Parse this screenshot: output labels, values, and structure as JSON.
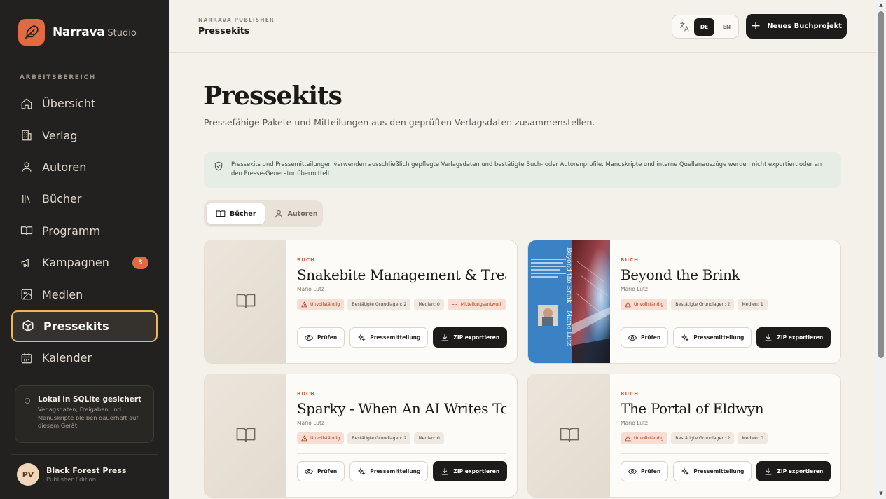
{
  "brand": {
    "name": "Narrava",
    "suffix": "Studio"
  },
  "sidebar": {
    "section_label": "ARBEITSBEREICH",
    "items": [
      {
        "label": "Übersicht",
        "icon": "home-icon"
      },
      {
        "label": "Verlag",
        "icon": "building-icon"
      },
      {
        "label": "Autoren",
        "icon": "user-icon"
      },
      {
        "label": "Bücher",
        "icon": "library-icon"
      },
      {
        "label": "Programm",
        "icon": "open-book-icon"
      },
      {
        "label": "Kampagnen",
        "icon": "megaphone-icon",
        "badge": "3"
      },
      {
        "label": "Medien",
        "icon": "image-icon"
      },
      {
        "label": "Pressekits",
        "icon": "package-icon",
        "active": true
      },
      {
        "label": "Kalender",
        "icon": "calendar-icon"
      }
    ],
    "storage": {
      "title": "Lokal in SQLite gesichert",
      "text": "Verlagsdaten, Freigaben und Manuskripte bleiben dauerhaft auf diesem Gerät."
    },
    "user": {
      "initials": "PV",
      "name": "Black Forest Press",
      "edition": "Publisher Edition"
    }
  },
  "header": {
    "kicker": "NARRAVA PUBLISHER",
    "title": "Pressekits",
    "lang": {
      "de": "DE",
      "en": "EN",
      "selected": "DE"
    },
    "new_button": "Neues Buchprojekt"
  },
  "main": {
    "title": "Pressekits",
    "subtitle": "Pressefähige Pakete und Mitteilungen aus den geprüften Verlagsdaten zusammenstellen.",
    "notice": "Pressekits und Pressemitteilungen verwenden ausschließlich gepflegte Verlagsdaten und bestätigte Buch- oder Autorenprofile. Manuskripte und interne Quellenauszüge werden nicht exportiert oder an den Presse-Generator übermittelt.",
    "tabs": {
      "books": "Bücher",
      "authors": "Autoren"
    }
  },
  "cards": [
    {
      "kicker": "BUCH",
      "title": "Snakebite Management & Treat...",
      "author": "Mario Lutz",
      "chips": [
        "Unvollständig",
        "Bestätigte Grundlagen: 2",
        "Medien: 0",
        "Mitteilungsentwurf"
      ],
      "has_cover": false
    },
    {
      "kicker": "BUCH",
      "title": "Beyond the Brink",
      "author": "Mario Lutz",
      "chips": [
        "Unvollständig",
        "Bestätigte Grundlagen: 2",
        "Medien: 1"
      ],
      "has_cover": true,
      "cover_text": {
        "spine_title": "Beyond the Brink",
        "spine_author": "Mario Lutz"
      }
    },
    {
      "kicker": "BUCH",
      "title": "Sparky - When An AI Writes To ...",
      "author": "Mario Lutz",
      "chips": [
        "Unvollständig",
        "Bestätigte Grundlagen: 2",
        "Medien: 0"
      ],
      "has_cover": false
    },
    {
      "kicker": "BUCH",
      "title": "The Portal of Eldwyn",
      "author": "Mario Lutz",
      "chips": [
        "Unvollständig",
        "Bestätigte Grundlagen: 2",
        "Medien: 0"
      ],
      "has_cover": false
    }
  ],
  "card_actions": {
    "check": "Prüfen",
    "press_release": "Pressemitteilung",
    "export": "ZIP exportieren"
  },
  "colors": {
    "accent": "#e06a44",
    "sidebar": "#23211f",
    "active_border": "#e8b95c",
    "notice_bg": "#e5ede5"
  }
}
